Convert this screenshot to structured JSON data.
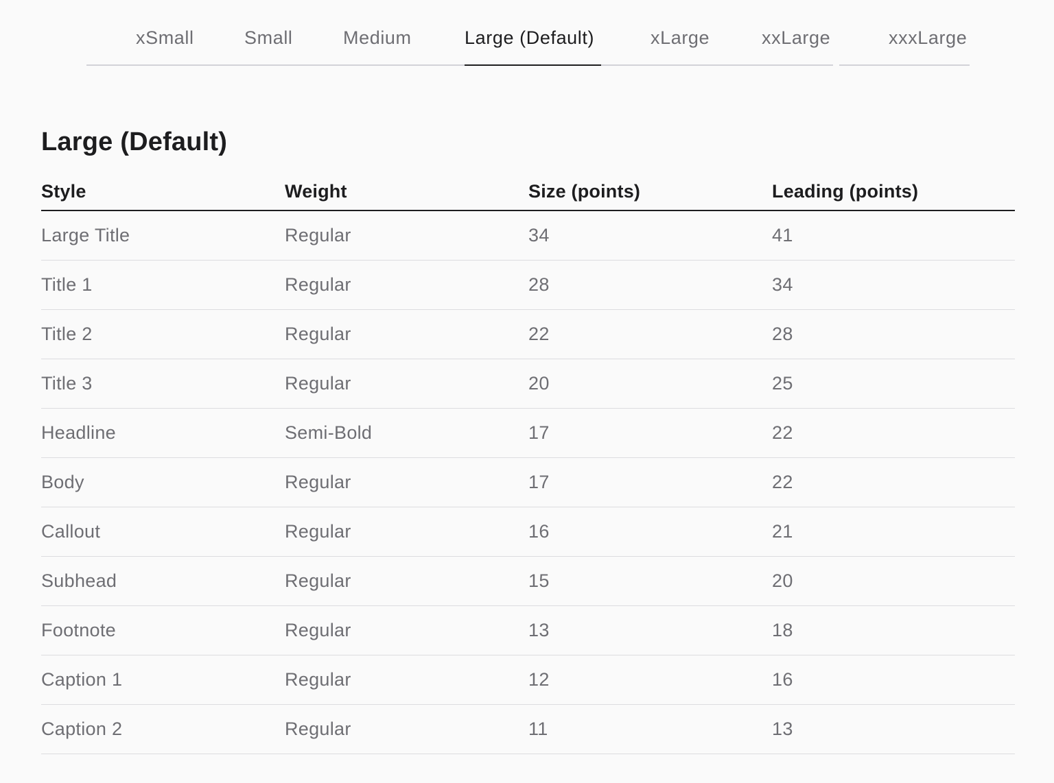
{
  "tabs": {
    "items": [
      {
        "label": "xSmall"
      },
      {
        "label": "Small"
      },
      {
        "label": "Medium"
      },
      {
        "label": "Large (Default)"
      },
      {
        "label": "xLarge"
      },
      {
        "label": "xxLarge"
      },
      {
        "label": "xxxLarge"
      }
    ],
    "selected": "Large (Default)"
  },
  "section": {
    "title": "Large (Default)"
  },
  "table": {
    "headers": [
      "Style",
      "Weight",
      "Size (points)",
      "Leading (points)"
    ],
    "rows": [
      [
        "Large Title",
        "Regular",
        "34",
        "41"
      ],
      [
        "Title 1",
        "Regular",
        "28",
        "34"
      ],
      [
        "Title 2",
        "Regular",
        "22",
        "28"
      ],
      [
        "Title 3",
        "Regular",
        "20",
        "25"
      ],
      [
        "Headline",
        "Semi-Bold",
        "17",
        "22"
      ],
      [
        "Body",
        "Regular",
        "17",
        "22"
      ],
      [
        "Callout",
        "Regular",
        "16",
        "21"
      ],
      [
        "Subhead",
        "Regular",
        "15",
        "20"
      ],
      [
        "Footnote",
        "Regular",
        "13",
        "18"
      ],
      [
        "Caption 1",
        "Regular",
        "12",
        "16"
      ],
      [
        "Caption 2",
        "Regular",
        "11",
        "13"
      ]
    ]
  },
  "colors": {
    "background": "#fafafa",
    "text_primary": "#1d1d1f",
    "text_secondary": "#6e6e73",
    "divider": "#dcdcdf"
  }
}
